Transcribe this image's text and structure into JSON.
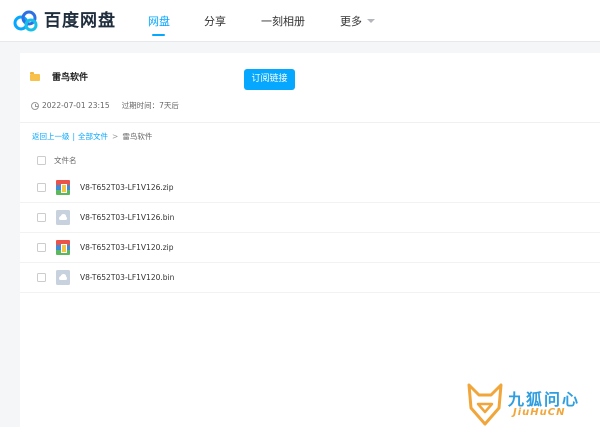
{
  "header": {
    "logo_text": "百度网盘",
    "nav": [
      {
        "label": "网盘",
        "active": true
      },
      {
        "label": "分享",
        "active": false
      },
      {
        "label": "一刻相册",
        "active": false
      },
      {
        "label": "更多",
        "active": false
      }
    ]
  },
  "share": {
    "title": "雷鸟软件",
    "subscribe_label": "订阅链接",
    "date": "2022-07-01 23:15",
    "expire_label": "过期时间：7天后"
  },
  "breadcrumb": {
    "back": "返回上一级",
    "separator": "|",
    "all_files": "全部文件",
    "arrow": ">",
    "current": "雷鸟软件"
  },
  "file_list": {
    "column_header": "文件名",
    "files": [
      {
        "name": "V8-T652T03-LF1V126.zip",
        "icon": "zip-archive-icon"
      },
      {
        "name": "V8-T652T03-LF1V126.bin",
        "icon": "cloud-file-icon"
      },
      {
        "name": "V8-T652T03-LF1V120.zip",
        "icon": "zip-archive-icon"
      },
      {
        "name": "V8-T652T03-LF1V120.bin",
        "icon": "cloud-file-icon"
      }
    ]
  },
  "watermark": {
    "text": "九狐问心",
    "sub": "JiuHuCN"
  },
  "colors": {
    "accent": "#06a7ff",
    "folder": "#f7c14c",
    "watermark_blue": "#2f9ee0",
    "watermark_orange": "#f0a63b"
  }
}
